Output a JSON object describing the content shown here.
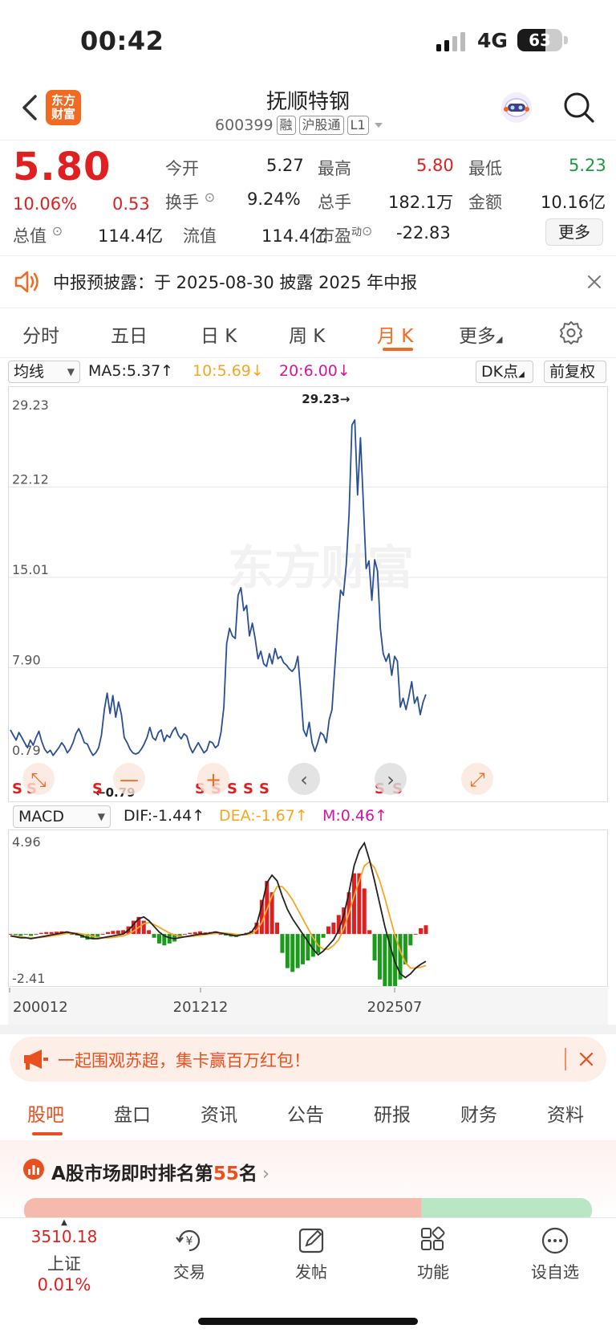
{
  "status": {
    "time": "00:42",
    "network": "4G",
    "battery": "63",
    "battery_level_percent": 63
  },
  "header": {
    "title": "抚顺特钢",
    "code": "600399",
    "tags": [
      "融",
      "沪股通",
      "L1"
    ],
    "logo_text": "东方财富"
  },
  "quote": {
    "price": "5.80",
    "change_pct": "10.06%",
    "change": "0.53",
    "open_label": "今开",
    "open": "5.27",
    "high_label": "最高",
    "high": "5.80",
    "low_label": "最低",
    "low": "5.23",
    "turnover_label": "换手",
    "turnover": "9.24%",
    "volume_label": "总手",
    "volume": "182.1万",
    "amount_label": "金额",
    "amount": "10.16亿",
    "mcap_label": "总值",
    "mcap": "114.4亿",
    "float_label": "流值",
    "float": "114.4亿",
    "pe_label": "市盈",
    "pe_sup": "动",
    "pe": "-22.83",
    "more_label": "更多"
  },
  "notice": {
    "text": "中报预披露：于 2025-08-30 披露 2025 年中报"
  },
  "period_tabs": {
    "items": [
      "分时",
      "五日",
      "日 K",
      "周 K",
      "月 K",
      "更多"
    ],
    "active": "月 K"
  },
  "chart_controls": {
    "ma_select": "均线",
    "ma5": "MA5:5.37↑",
    "ma10": "10:5.69↓",
    "ma20": "20:6.00↓",
    "dk": "DK点",
    "adj": "前复权",
    "watermark": "东方财富"
  },
  "macd_controls": {
    "select": "MACD",
    "dif": "DIF:-1.44↑",
    "dea": "DEA:-1.67↑",
    "m": "M:0.46↑"
  },
  "chart_data": [
    {
      "type": "line",
      "title": "",
      "y_ticks": [
        "29.23",
        "22.12",
        "15.01",
        "7.90",
        "0.79"
      ],
      "ylim": [
        0.79,
        29.23
      ],
      "annotations": {
        "max": "29.23→",
        "min": "←0.79"
      },
      "x_range": [
        "200012",
        "202507"
      ],
      "signal_labels": [
        "S",
        "S",
        "S",
        "S",
        "S",
        "S",
        "S",
        "S",
        "S",
        "S"
      ],
      "series": [
        {
          "values": [
            3.0,
            2.6,
            2.2,
            2.8,
            2.4,
            2.0,
            1.6,
            2.2,
            1.8,
            2.4,
            2.9,
            2.1,
            1.5,
            1.2,
            1.4,
            1.0,
            1.3,
            1.6,
            2.0,
            1.7,
            1.2,
            1.5,
            2.0,
            2.7,
            3.1,
            2.6,
            2.0,
            1.9,
            1.4,
            1.0,
            1.2,
            1.6,
            2.6,
            4.6,
            5.9,
            4.3,
            5.7,
            4.0,
            5.2,
            4.2,
            2.4,
            2.0,
            1.5,
            1.2,
            1.1,
            1.2,
            1.5,
            1.9,
            2.4,
            3.2,
            2.4,
            2.2,
            2.8,
            3.0,
            2.1,
            2.6,
            2.4,
            2.9,
            3.2,
            2.6,
            2.3,
            2.7,
            2.5,
            1.7,
            1.2,
            1.6,
            2.0,
            1.6,
            1.2,
            1.4,
            2.1,
            2.0,
            1.6,
            1.8,
            2.8,
            4.8,
            9.8,
            11.0,
            10.4,
            10.2,
            13.6,
            14.2,
            12.4,
            12.8,
            10.4,
            11.4,
            10.2,
            8.6,
            9.2,
            8.2,
            8.0,
            9.0,
            8.2,
            9.4,
            8.6,
            8.8,
            8.3,
            8.1,
            7.8,
            7.6,
            7.9,
            8.8,
            6.0,
            3.0,
            2.5,
            3.6,
            2.0,
            1.3,
            2.0,
            2.8,
            2.6,
            2.0,
            3.8,
            4.6,
            8.0,
            11.2,
            14.0,
            13.6,
            16.0,
            20.0,
            27.0,
            27.4,
            21.5,
            26.0,
            21.0,
            15.7,
            16.3,
            13.2,
            16.4,
            15.5,
            11.0,
            9.0,
            8.4,
            9.0,
            7.3,
            8.8,
            8.4,
            4.8,
            5.5,
            4.6,
            5.6,
            6.8,
            5.1,
            5.6,
            4.2,
            5.2,
            5.8
          ]
        }
      ]
    },
    {
      "type": "bar",
      "title": "",
      "y_ticks": [
        "4.96",
        "-2.41"
      ],
      "ylim": [
        -2.41,
        4.96
      ],
      "x_ticks": [
        "200012",
        "201212",
        "202507"
      ],
      "series": [
        {
          "name": "DIF",
          "values": [
            -0.1,
            -0.15,
            -0.2,
            -0.2,
            -0.25,
            -0.2,
            -0.15,
            -0.1,
            -0.05,
            0.0,
            0.05,
            0.1,
            0.05,
            0.0,
            -0.1,
            -0.2,
            -0.25,
            -0.25,
            -0.2,
            -0.15,
            -0.1,
            -0.05,
            0.0,
            0.2,
            0.5,
            0.8,
            0.9,
            0.7,
            0.4,
            0.1,
            -0.1,
            -0.2,
            -0.25,
            -0.2,
            -0.15,
            -0.1,
            -0.05,
            0.0,
            0.0,
            0.05,
            0.1,
            0.05,
            0.0,
            -0.05,
            -0.1,
            -0.05,
            0.0,
            0.1,
            0.5,
            1.5,
            2.7,
            3.1,
            2.8,
            2.0,
            1.3,
            0.8,
            0.4,
            0.0,
            -0.4,
            -0.8,
            -1.1,
            -0.9,
            -0.6,
            -0.3,
            0.2,
            1.0,
            2.2,
            3.6,
            4.4,
            4.8,
            3.9,
            2.8,
            1.6,
            0.4,
            -0.6,
            -1.5,
            -2.1,
            -2.3,
            -2.1,
            -1.8,
            -1.6,
            -1.44
          ]
        },
        {
          "name": "DEA",
          "values": [
            -0.1,
            -0.12,
            -0.15,
            -0.18,
            -0.2,
            -0.2,
            -0.18,
            -0.15,
            -0.1,
            -0.06,
            -0.02,
            0.03,
            0.05,
            0.04,
            0.0,
            -0.05,
            -0.12,
            -0.18,
            -0.2,
            -0.2,
            -0.18,
            -0.14,
            -0.1,
            0.0,
            0.15,
            0.35,
            0.55,
            0.6,
            0.5,
            0.35,
            0.2,
            0.05,
            -0.05,
            -0.12,
            -0.15,
            -0.13,
            -0.1,
            -0.07,
            -0.04,
            0.0,
            0.03,
            0.05,
            0.04,
            0.02,
            -0.02,
            -0.04,
            -0.03,
            0.02,
            0.2,
            0.6,
            1.3,
            2.0,
            2.5,
            2.5,
            2.2,
            1.8,
            1.3,
            0.8,
            0.3,
            -0.2,
            -0.6,
            -0.8,
            -0.8,
            -0.6,
            -0.3,
            0.3,
            1.1,
            2.0,
            2.8,
            3.6,
            3.8,
            3.5,
            2.8,
            1.9,
            0.9,
            -0.1,
            -0.9,
            -1.5,
            -1.8,
            -1.8,
            -1.75,
            -1.67
          ]
        },
        {
          "name": "M",
          "values": [
            0.0,
            -0.06,
            -0.1,
            -0.04,
            -0.1,
            0.0,
            0.06,
            0.1,
            0.1,
            0.12,
            0.14,
            0.14,
            0.0,
            -0.08,
            -0.2,
            -0.3,
            -0.26,
            -0.14,
            0.0,
            0.1,
            0.16,
            0.18,
            0.2,
            0.4,
            0.7,
            0.9,
            0.7,
            0.2,
            -0.2,
            -0.5,
            -0.6,
            -0.5,
            -0.4,
            -0.16,
            0.0,
            0.06,
            0.1,
            0.14,
            0.08,
            0.1,
            0.14,
            0.0,
            -0.08,
            -0.14,
            -0.16,
            -0.02,
            0.06,
            0.16,
            0.6,
            1.8,
            2.8,
            2.2,
            0.6,
            -1.0,
            -1.8,
            -2.0,
            -1.8,
            -1.6,
            -1.4,
            -1.2,
            -1.0,
            -0.2,
            0.4,
            0.6,
            1.0,
            1.4,
            2.2,
            3.2,
            3.2,
            2.4,
            0.2,
            -1.4,
            -2.4,
            -3.0,
            -3.0,
            -2.8,
            -2.4,
            -1.6,
            -0.6,
            0.0,
            0.3,
            0.46
          ]
        }
      ]
    }
  ],
  "promo": {
    "text": "一起围观苏超，集卡赢百万红包！"
  },
  "bottom_tabs": {
    "items": [
      "股吧",
      "盘口",
      "资讯",
      "公告",
      "研报",
      "财务",
      "资料"
    ],
    "active": "股吧"
  },
  "rank": {
    "prefix": "A股市场即时排名第",
    "rank": "55",
    "suffix": "名"
  },
  "bottom_nav": {
    "index_value": "3510.18",
    "index_name": "上证",
    "index_change": "0.01%",
    "trade": "交易",
    "post": "发帖",
    "func": "功能",
    "watch": "设自选"
  }
}
